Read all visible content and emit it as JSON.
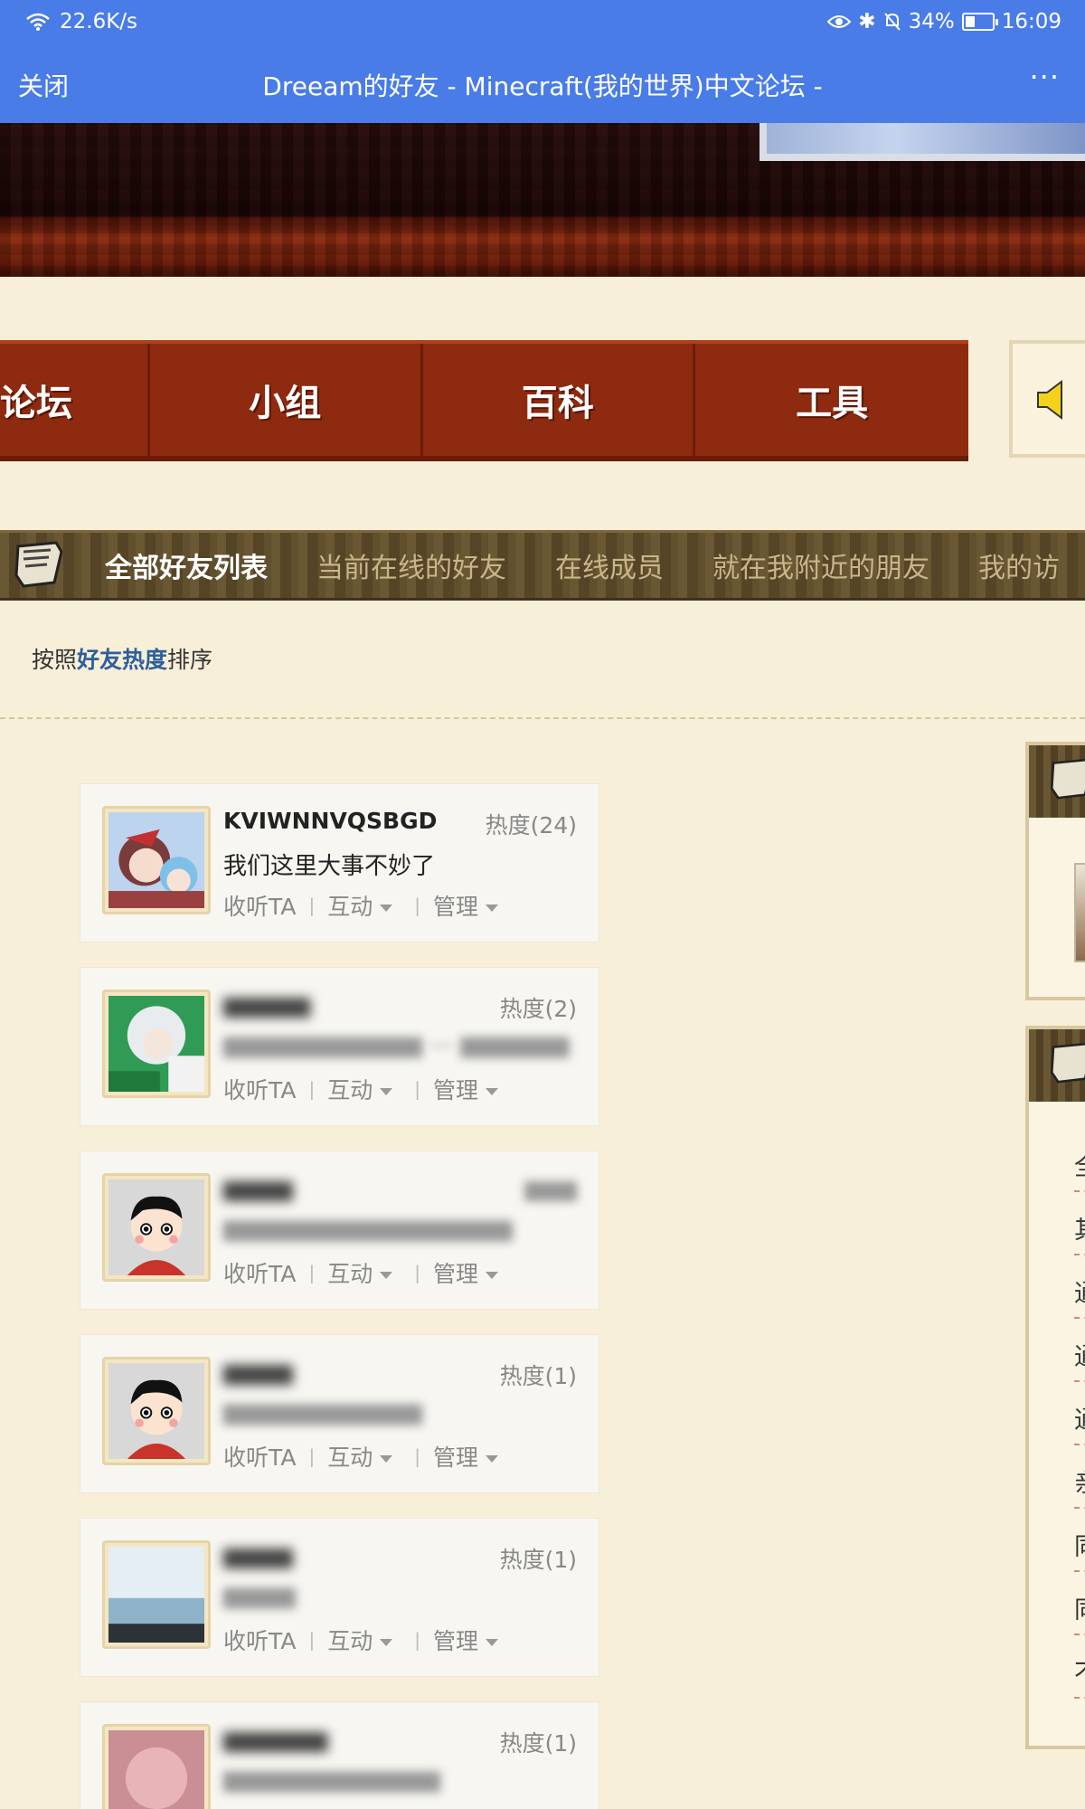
{
  "status_bar": {
    "network_speed": "22.6K/s",
    "battery": "34%",
    "battery_fraction": 0.34,
    "time": "16:09"
  },
  "titlebar": {
    "close_label": "关闭",
    "title": "Dreeam的好友 - Minecraft(我的世界)中文论坛 -",
    "more_label": "···"
  },
  "nav": {
    "items": [
      "论坛",
      "小组",
      "百科",
      "工具"
    ]
  },
  "subnav": {
    "items": [
      "全部好友列表",
      "当前在线的好友",
      "在线成员",
      "就在我附近的朋友",
      "我的访"
    ]
  },
  "sort": {
    "prefix": "按照",
    "highlight": "好友热度",
    "suffix": "排序"
  },
  "friends": [
    {
      "name": "KVIWNNVQSBGD",
      "heat": "热度(24)",
      "message": "我们这里大事不妙了",
      "avatar": "anime-girls"
    },
    {
      "name": "",
      "heat": "热度(2)",
      "message": "",
      "avatar": "anime-white-hair"
    },
    {
      "name": "",
      "heat": "热度(1)",
      "message": "",
      "avatar": "default-boy"
    },
    {
      "name": "",
      "heat": "热度(1)",
      "message": "",
      "avatar": "default-boy"
    },
    {
      "name": "",
      "heat": "热度(1)",
      "message": "",
      "avatar": "sea"
    },
    {
      "name": "",
      "heat": "热度(1)",
      "message": "",
      "avatar": "pink-anime"
    }
  ],
  "actions": {
    "follow": "收听TA",
    "interact": "互动",
    "manage": "管理"
  },
  "sidebar": {
    "rows": [
      "全",
      "其",
      "通",
      "通",
      "通",
      "亲",
      "同",
      "同",
      "不"
    ]
  }
}
